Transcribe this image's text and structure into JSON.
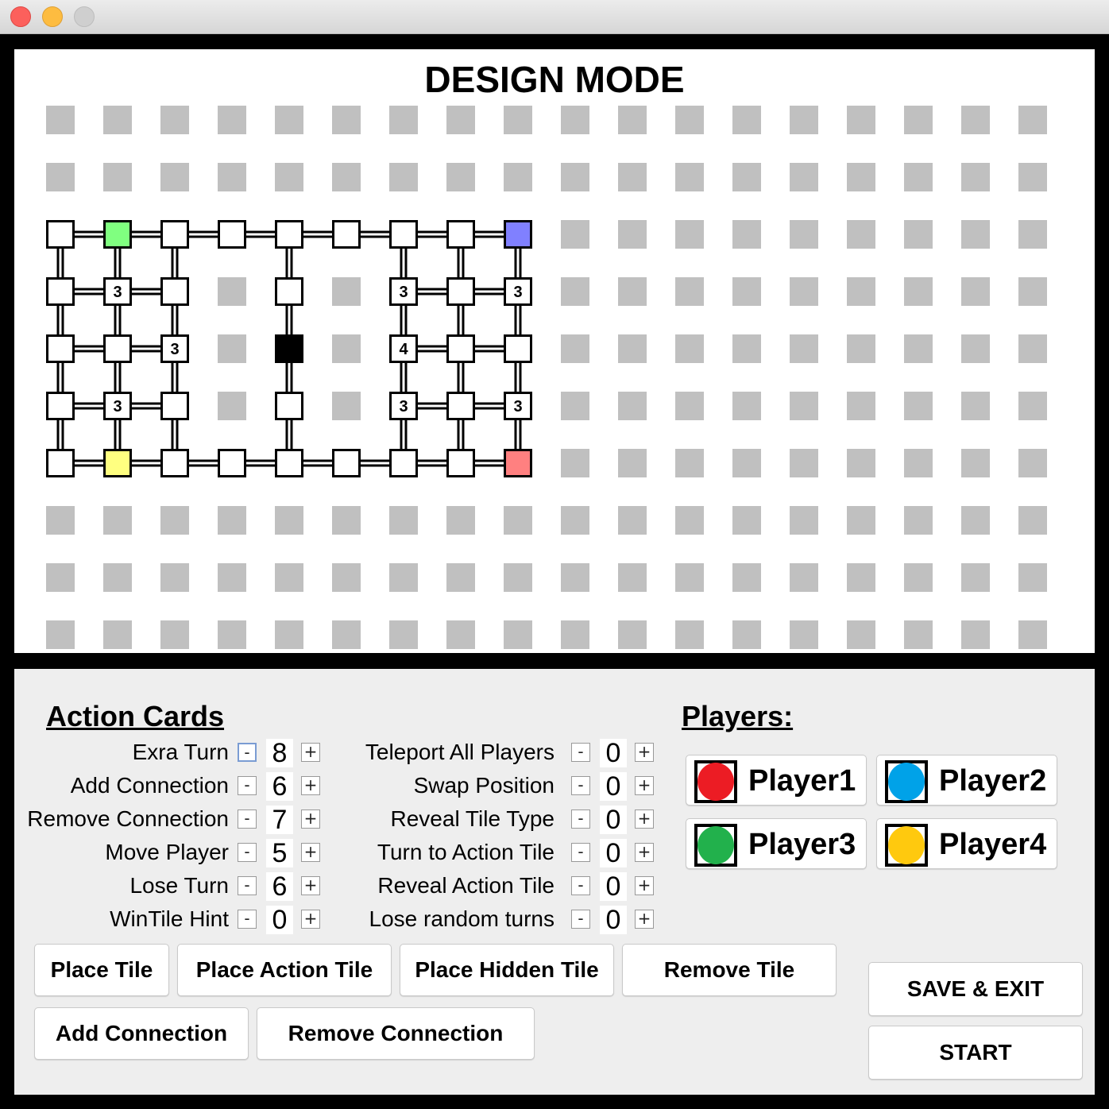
{
  "window": {
    "close": "close",
    "minimize": "minimize",
    "maximize": "maximize"
  },
  "board": {
    "title": "DESIGN MODE",
    "grid": {
      "columns": 18,
      "rows": 10
    },
    "tiles": [
      {
        "col": 0,
        "row": 2
      },
      {
        "col": 1,
        "row": 2,
        "color": "#80ff80"
      },
      {
        "col": 2,
        "row": 2
      },
      {
        "col": 3,
        "row": 2
      },
      {
        "col": 4,
        "row": 2
      },
      {
        "col": 5,
        "row": 2
      },
      {
        "col": 6,
        "row": 2
      },
      {
        "col": 7,
        "row": 2
      },
      {
        "col": 8,
        "row": 2,
        "color": "#8080ff"
      },
      {
        "col": 0,
        "row": 3
      },
      {
        "col": 1,
        "row": 3,
        "label": "3"
      },
      {
        "col": 2,
        "row": 3
      },
      {
        "col": 4,
        "row": 3
      },
      {
        "col": 6,
        "row": 3,
        "label": "3"
      },
      {
        "col": 7,
        "row": 3
      },
      {
        "col": 8,
        "row": 3,
        "label": "3"
      },
      {
        "col": 0,
        "row": 4
      },
      {
        "col": 1,
        "row": 4
      },
      {
        "col": 2,
        "row": 4,
        "label": "3"
      },
      {
        "col": 4,
        "row": 4,
        "color": "#000000"
      },
      {
        "col": 6,
        "row": 4,
        "label": "4"
      },
      {
        "col": 7,
        "row": 4
      },
      {
        "col": 8,
        "row": 4
      },
      {
        "col": 0,
        "row": 5
      },
      {
        "col": 1,
        "row": 5,
        "label": "3"
      },
      {
        "col": 2,
        "row": 5
      },
      {
        "col": 4,
        "row": 5
      },
      {
        "col": 6,
        "row": 5,
        "label": "3"
      },
      {
        "col": 7,
        "row": 5
      },
      {
        "col": 8,
        "row": 5,
        "label": "3"
      },
      {
        "col": 0,
        "row": 6
      },
      {
        "col": 1,
        "row": 6,
        "color": "#ffff80"
      },
      {
        "col": 2,
        "row": 6
      },
      {
        "col": 3,
        "row": 6
      },
      {
        "col": 4,
        "row": 6
      },
      {
        "col": 5,
        "row": 6
      },
      {
        "col": 6,
        "row": 6
      },
      {
        "col": 7,
        "row": 6
      },
      {
        "col": 8,
        "row": 6,
        "color": "#ff8080"
      }
    ],
    "connections": [
      [
        [
          0,
          2
        ],
        [
          1,
          2
        ]
      ],
      [
        [
          1,
          2
        ],
        [
          2,
          2
        ]
      ],
      [
        [
          2,
          2
        ],
        [
          3,
          2
        ]
      ],
      [
        [
          3,
          2
        ],
        [
          4,
          2
        ]
      ],
      [
        [
          4,
          2
        ],
        [
          5,
          2
        ]
      ],
      [
        [
          5,
          2
        ],
        [
          6,
          2
        ]
      ],
      [
        [
          6,
          2
        ],
        [
          7,
          2
        ]
      ],
      [
        [
          7,
          2
        ],
        [
          8,
          2
        ]
      ],
      [
        [
          0,
          6
        ],
        [
          1,
          6
        ]
      ],
      [
        [
          1,
          6
        ],
        [
          2,
          6
        ]
      ],
      [
        [
          2,
          6
        ],
        [
          3,
          6
        ]
      ],
      [
        [
          3,
          6
        ],
        [
          4,
          6
        ]
      ],
      [
        [
          4,
          6
        ],
        [
          5,
          6
        ]
      ],
      [
        [
          5,
          6
        ],
        [
          6,
          6
        ]
      ],
      [
        [
          6,
          6
        ],
        [
          7,
          6
        ]
      ],
      [
        [
          7,
          6
        ],
        [
          8,
          6
        ]
      ],
      [
        [
          0,
          3
        ],
        [
          1,
          3
        ]
      ],
      [
        [
          1,
          3
        ],
        [
          2,
          3
        ]
      ],
      [
        [
          0,
          4
        ],
        [
          1,
          4
        ]
      ],
      [
        [
          1,
          4
        ],
        [
          2,
          4
        ]
      ],
      [
        [
          0,
          5
        ],
        [
          1,
          5
        ]
      ],
      [
        [
          1,
          5
        ],
        [
          2,
          5
        ]
      ],
      [
        [
          6,
          3
        ],
        [
          7,
          3
        ]
      ],
      [
        [
          7,
          3
        ],
        [
          8,
          3
        ]
      ],
      [
        [
          6,
          4
        ],
        [
          7,
          4
        ]
      ],
      [
        [
          7,
          4
        ],
        [
          8,
          4
        ]
      ],
      [
        [
          6,
          5
        ],
        [
          7,
          5
        ]
      ],
      [
        [
          7,
          5
        ],
        [
          8,
          5
        ]
      ],
      [
        [
          0,
          2
        ],
        [
          0,
          3
        ]
      ],
      [
        [
          0,
          3
        ],
        [
          0,
          4
        ]
      ],
      [
        [
          0,
          4
        ],
        [
          0,
          5
        ]
      ],
      [
        [
          0,
          5
        ],
        [
          0,
          6
        ]
      ],
      [
        [
          1,
          2
        ],
        [
          1,
          3
        ]
      ],
      [
        [
          1,
          3
        ],
        [
          1,
          4
        ]
      ],
      [
        [
          1,
          4
        ],
        [
          1,
          5
        ]
      ],
      [
        [
          1,
          5
        ],
        [
          1,
          6
        ]
      ],
      [
        [
          2,
          2
        ],
        [
          2,
          3
        ]
      ],
      [
        [
          2,
          3
        ],
        [
          2,
          4
        ]
      ],
      [
        [
          2,
          4
        ],
        [
          2,
          5
        ]
      ],
      [
        [
          2,
          5
        ],
        [
          2,
          6
        ]
      ],
      [
        [
          4,
          2
        ],
        [
          4,
          3
        ]
      ],
      [
        [
          4,
          3
        ],
        [
          4,
          4
        ]
      ],
      [
        [
          4,
          4
        ],
        [
          4,
          5
        ]
      ],
      [
        [
          4,
          5
        ],
        [
          4,
          6
        ]
      ],
      [
        [
          6,
          2
        ],
        [
          6,
          3
        ]
      ],
      [
        [
          6,
          3
        ],
        [
          6,
          4
        ]
      ],
      [
        [
          6,
          4
        ],
        [
          6,
          5
        ]
      ],
      [
        [
          6,
          5
        ],
        [
          6,
          6
        ]
      ],
      [
        [
          7,
          2
        ],
        [
          7,
          3
        ]
      ],
      [
        [
          7,
          3
        ],
        [
          7,
          4
        ]
      ],
      [
        [
          7,
          4
        ],
        [
          7,
          5
        ]
      ],
      [
        [
          7,
          5
        ],
        [
          7,
          6
        ]
      ],
      [
        [
          8,
          2
        ],
        [
          8,
          3
        ]
      ],
      [
        [
          8,
          3
        ],
        [
          8,
          4
        ]
      ],
      [
        [
          8,
          4
        ],
        [
          8,
          5
        ]
      ],
      [
        [
          8,
          5
        ],
        [
          8,
          6
        ]
      ]
    ]
  },
  "action_cards": {
    "heading": "Action Cards",
    "minus": "-",
    "plus": "+",
    "left": [
      {
        "label": "Exra Turn",
        "count": "8"
      },
      {
        "label": "Add Connection",
        "count": "6"
      },
      {
        "label": "Remove Connection",
        "count": "7"
      },
      {
        "label": "Move Player",
        "count": "5"
      },
      {
        "label": "Lose Turn",
        "count": "6"
      },
      {
        "label": "WinTile Hint",
        "count": "0"
      }
    ],
    "right": [
      {
        "label": "Teleport All Players",
        "count": "0"
      },
      {
        "label": "Swap Position",
        "count": "0"
      },
      {
        "label": "Reveal Tile Type",
        "count": "0"
      },
      {
        "label": "Turn to Action Tile",
        "count": "0"
      },
      {
        "label": "Reveal Action Tile",
        "count": "0"
      },
      {
        "label": "Lose random turns",
        "count": "0"
      }
    ]
  },
  "players": {
    "heading": "Players:",
    "list": [
      {
        "name": "Player1",
        "color": "#ec1c24"
      },
      {
        "name": "Player2",
        "color": "#00a2e8"
      },
      {
        "name": "Player3",
        "color": "#22b14c"
      },
      {
        "name": "Player4",
        "color": "#ffc90e"
      }
    ]
  },
  "tools": {
    "place_tile": "Place Tile",
    "place_action_tile": "Place Action Tile",
    "place_hidden_tile": "Place Hidden Tile",
    "remove_tile": "Remove Tile",
    "add_connection": "Add Connection",
    "remove_connection": "Remove Connection"
  },
  "actions": {
    "save_exit": "SAVE & EXIT",
    "start": "START"
  }
}
